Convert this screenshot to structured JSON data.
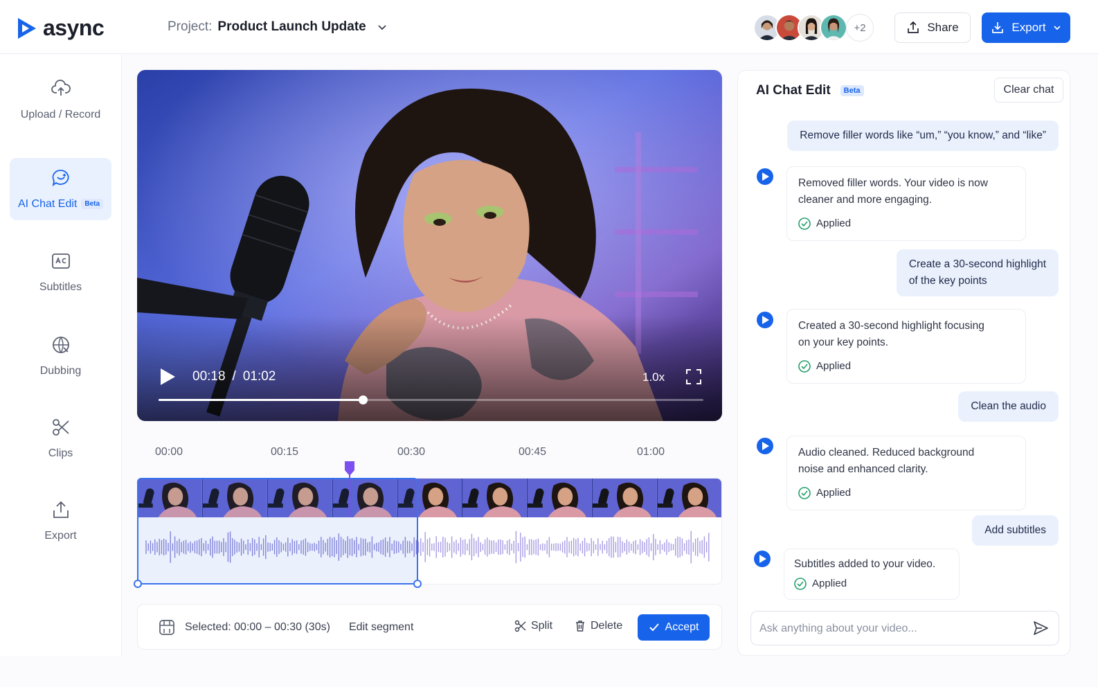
{
  "app": {
    "name": "async"
  },
  "header": {
    "project_label": "Project:",
    "project_name": "Product  Launch Update",
    "more_collaborators": "+2",
    "share_label": "Share",
    "export_label": "Export"
  },
  "sidebar": {
    "items": [
      {
        "label": "Upload / Record",
        "icon": "upload-cloud-icon"
      },
      {
        "label": "AI Chat Edit",
        "badge": "Beta",
        "icon": "ai-chat-icon",
        "active": true
      },
      {
        "label": "Subtitles",
        "icon": "subtitles-icon"
      },
      {
        "label": "Dubbing",
        "icon": "dubbing-icon"
      },
      {
        "label": "Clips",
        "icon": "scissors-icon"
      },
      {
        "label": "Export",
        "icon": "export-icon"
      }
    ]
  },
  "player": {
    "current_time": "00:18",
    "separator": "/",
    "duration": "01:02",
    "speed": "1.0x",
    "progress": 0.375
  },
  "timeline": {
    "ticks": [
      "00:00",
      "00:15",
      "00:30",
      "00:45",
      "01:00"
    ],
    "selection_start_fraction": 0,
    "selection_end_fraction": 0.48
  },
  "bottombar": {
    "selected_label": "Selected:  00:00 – 00:30 (30s)",
    "edit_segment": "Edit segment",
    "split": "Split",
    "delete": "Delete",
    "accept": "Accept"
  },
  "chat": {
    "title": "AI Chat Edit",
    "badge": "Beta",
    "clear_chat": "Clear chat",
    "messages": [
      {
        "role": "user",
        "text": "Remove filler words like “um,” “you know,” and “like”"
      },
      {
        "role": "ai",
        "lines": [
          "Removed filler words. Your video is now",
          "cleaner and more engaging."
        ],
        "status": "Applied"
      },
      {
        "role": "user",
        "lines": [
          "Create a 30-second highlight",
          "of the key points"
        ]
      },
      {
        "role": "ai",
        "lines": [
          "Created a 30-second highlight focusing",
          "on your key points."
        ],
        "status": "Applied"
      },
      {
        "role": "user",
        "text": "Clean the audio"
      },
      {
        "role": "ai",
        "lines": [
          "Audio cleaned. Reduced background",
          "noise and enhanced clarity."
        ],
        "status": "Applied"
      },
      {
        "role": "user",
        "text": "Add subtitles"
      },
      {
        "role": "ai",
        "lines": [
          "Subtitles added to your video."
        ],
        "status": "Applied"
      }
    ],
    "input_placeholder": "Ask anything about your video..."
  },
  "colors": {
    "accent": "#1763ea",
    "playhead": "#7b4ff0",
    "selection": "#3a72ec",
    "applied": "#22a06b"
  }
}
